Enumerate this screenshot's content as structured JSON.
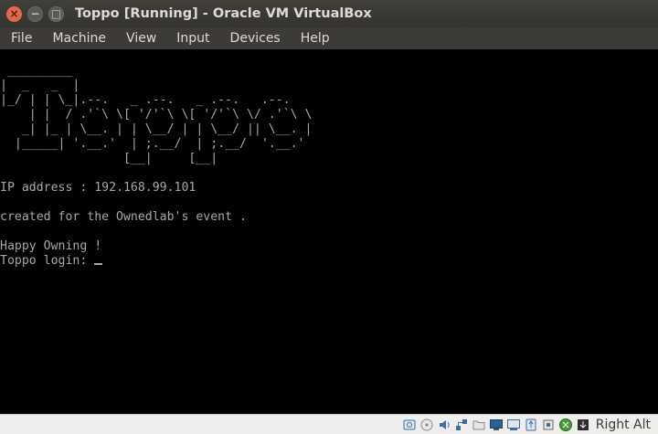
{
  "window": {
    "title": "Toppo [Running] - Oracle VM VirtualBox",
    "close_glyph": "×",
    "minimize_glyph": "−",
    "maximize_glyph": "□"
  },
  "menu": {
    "items": [
      "File",
      "Machine",
      "View",
      "Input",
      "Devices",
      "Help"
    ]
  },
  "console": {
    "banner": [
      " _________",
      "|  _   _  |",
      "|_/ | | \\_|.--.   _ .--.   _ .--.   .--.",
      "    | |  / .'`\\ \\[ '/'`\\ \\[ '/'`\\ \\/ .'`\\ \\",
      "   _| |_ | \\__. | | \\__/ | | \\__/ || \\__. |",
      "  |_____| '.__.'  | ;.__/  | ;.__/  '.__.'",
      "                 [__|     [__|"
    ],
    "ip_line": "IP address : 192.168.99.101",
    "created_line": "created for the Ownedlab's event .",
    "happy_line": "Happy Owning !",
    "login_prompt": "Toppo login: "
  },
  "statusbar": {
    "icons": [
      "hard-disk-icon",
      "optical-drive-icon",
      "audio-icon",
      "network-icon",
      "shared-folders-icon",
      "display-icon",
      "video-capture-icon",
      "usb-icon",
      "cpu-icon",
      "mouse-integration-icon",
      "keyboard-capture-icon"
    ],
    "host_key": "Right Alt"
  }
}
